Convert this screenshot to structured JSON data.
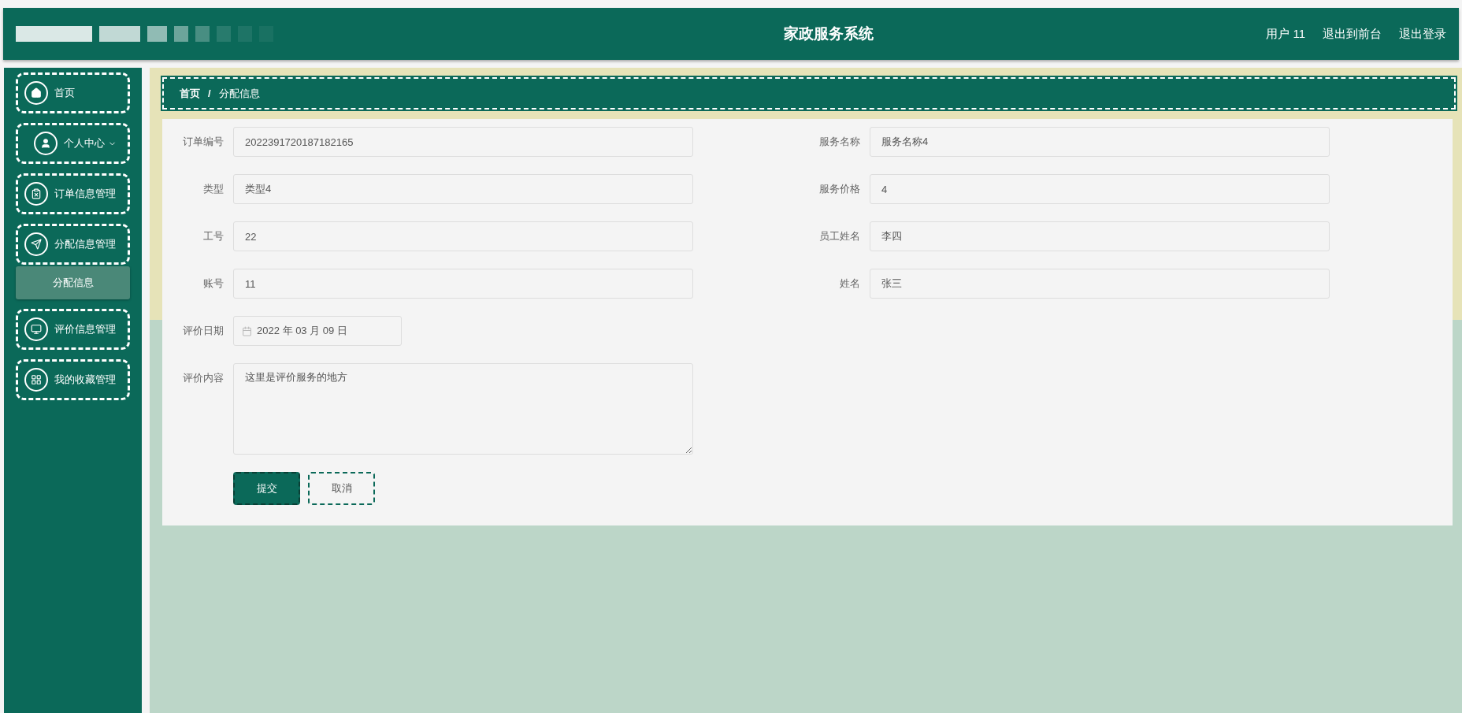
{
  "header": {
    "title": "家政服务系统",
    "user": "用户 11",
    "links": [
      "退出到前台",
      "退出登录"
    ]
  },
  "sidebar": {
    "items": [
      {
        "kind": "link",
        "label": "首页",
        "selected": false
      },
      {
        "kind": "dropdown",
        "label": "个人中心",
        "selected": false
      },
      {
        "kind": "link",
        "label": "订单信息管理",
        "selected": false
      },
      {
        "kind": "link",
        "label": "分配信息管理",
        "selected": false,
        "children": [
          {
            "label": "分配信息",
            "selected": true
          }
        ]
      },
      {
        "kind": "link",
        "label": "评价信息管理",
        "selected": false
      },
      {
        "kind": "link",
        "label": "我的收藏管理",
        "selected": false
      }
    ]
  },
  "breadcrumb": [
    "首页",
    "分配信息"
  ],
  "breadcrumb_separator": "/",
  "form": {
    "left_fields": [
      {
        "kind": "text",
        "label": "订单编号",
        "value": "2022391720187182165"
      },
      {
        "kind": "text",
        "label": "类型",
        "value": "类型4"
      },
      {
        "kind": "text",
        "label": "工号",
        "value": "22"
      },
      {
        "kind": "text",
        "label": "账号",
        "value": "11"
      },
      {
        "kind": "date",
        "label": "评价日期",
        "value": "2022 年 03 月 09 日"
      },
      {
        "kind": "textarea",
        "label": "评价内容",
        "value": "这里是评价服务的地方"
      }
    ],
    "right_fields": [
      {
        "kind": "text",
        "label": "服务名称",
        "value": "服务名称4"
      },
      {
        "kind": "text",
        "label": "服务价格",
        "value": "4"
      },
      {
        "kind": "text",
        "label": "员工姓名",
        "value": "李四"
      },
      {
        "kind": "text",
        "label": "姓名",
        "value": "张三"
      }
    ],
    "buttons": [
      {
        "kind": "primary",
        "label": "提交"
      },
      {
        "kind": "secondary",
        "label": "取消"
      }
    ]
  }
}
